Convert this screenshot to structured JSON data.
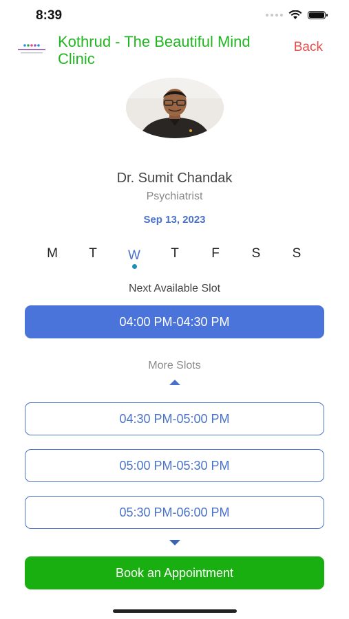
{
  "status_bar": {
    "time": "8:39"
  },
  "header": {
    "clinic_name": "Kothrud - The Beautiful Mind Clinic",
    "back_label": "Back"
  },
  "doctor": {
    "name": "Dr. Sumit Chandak",
    "title": "Psychiatrist"
  },
  "selected_date": "Sep 13, 2023",
  "week": {
    "days": [
      "M",
      "T",
      "W",
      "T",
      "F",
      "S",
      "S"
    ],
    "selected_index": 2
  },
  "slots": {
    "next_label": "Next Available Slot",
    "next_slot": "04:00 PM-04:30 PM",
    "more_label": "More Slots",
    "more": [
      "04:30 PM-05:00 PM",
      "05:00 PM-05:30 PM",
      "05:30 PM-06:00 PM"
    ]
  },
  "book_label": "Book an Appointment",
  "colors": {
    "clinic_green": "#22b522",
    "back_red": "#e84c4c",
    "accent_blue": "#4a74d9",
    "book_green": "#1aaf10"
  }
}
